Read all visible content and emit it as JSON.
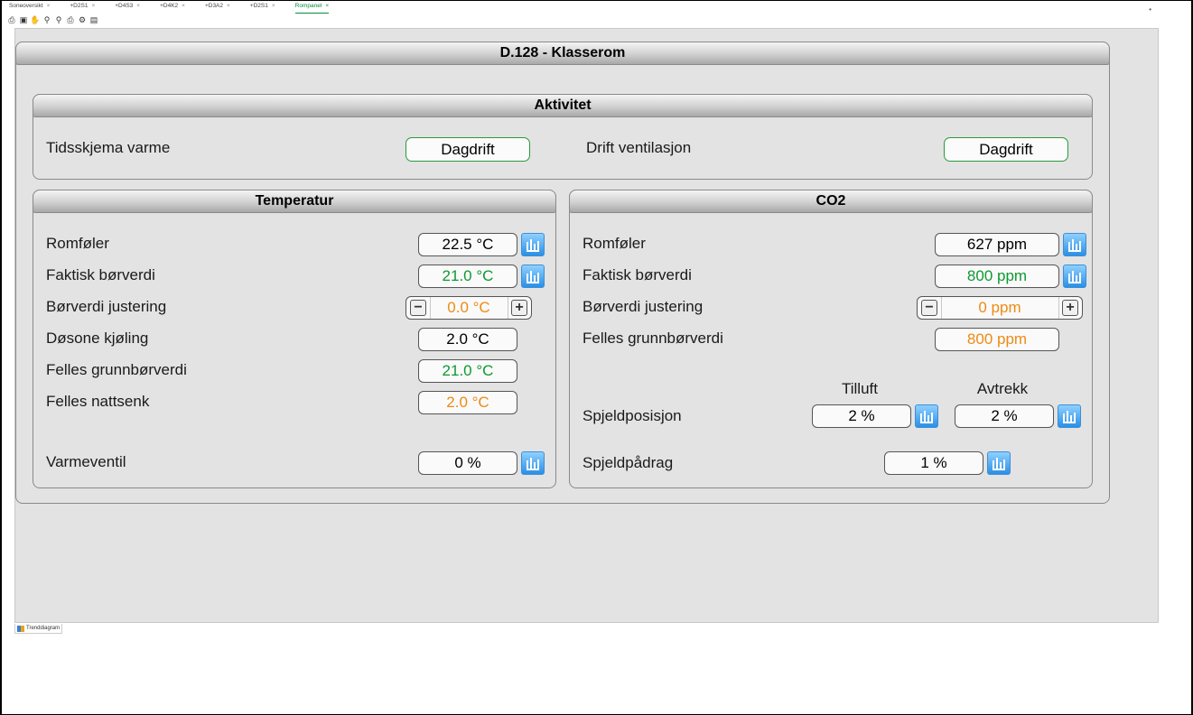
{
  "tabs": [
    {
      "label": "Soneoversikt",
      "close": "×",
      "active": false
    },
    {
      "label": "+D2S1",
      "close": "×",
      "active": false
    },
    {
      "label": "+D4S3",
      "close": "×",
      "active": false
    },
    {
      "label": "+D4K2",
      "close": "×",
      "active": false
    },
    {
      "label": "+D3A2",
      "close": "×",
      "active": false
    },
    {
      "label": "+D2S1",
      "close": "×",
      "active": false
    },
    {
      "label": "Rompanel",
      "close": "×",
      "active": true
    }
  ],
  "toolbar_icons": [
    "print-icon",
    "save-icon",
    "pan-icon",
    "zoom-in-icon",
    "zoom-out-icon",
    "print-preview-icon",
    "settings-icon",
    "document-icon"
  ],
  "window_dot": "•",
  "room": {
    "title": "D.128 - Klasserom"
  },
  "aktivitet": {
    "title": "Aktivitet",
    "heat_schedule_label": "Tidsskjema varme",
    "heat_schedule_value": "Dagdrift",
    "vent_label": "Drift ventilasjon",
    "vent_value": "Dagdrift"
  },
  "temperatur": {
    "title": "Temperatur",
    "room_sensor_label": "Romføler",
    "room_sensor_value": "22.5 °C",
    "actual_setpoint_label": "Faktisk børverdi",
    "actual_setpoint_value": "21.0 °C",
    "setpoint_adjust_label": "Børverdi justering",
    "setpoint_adjust_value": "0.0 °C",
    "minus": "−",
    "plus": "+",
    "deadband_label": "Døsone kjøling",
    "deadband_value": "2.0 °C",
    "common_base_label": "Felles grunnbørverdi",
    "common_base_value": "21.0 °C",
    "night_setback_label": "Felles nattsenk",
    "night_setback_value": "2.0 °C",
    "heating_valve_label": "Varmeventil",
    "heating_valve_value": "0 %"
  },
  "co2": {
    "title": "CO2",
    "room_sensor_label": "Romføler",
    "room_sensor_value": "627 ppm",
    "actual_setpoint_label": "Faktisk børverdi",
    "actual_setpoint_value": "800 ppm",
    "setpoint_adjust_label": "Børverdi justering",
    "setpoint_adjust_value": "0 ppm",
    "minus": "−",
    "plus": "+",
    "common_base_label": "Felles grunnbørverdi",
    "common_base_value": "800 ppm",
    "supply_header": "Tilluft",
    "exhaust_header": "Avtrekk",
    "damper_pos_label": "Spjeldposisjon",
    "damper_supply_value": "2 %",
    "damper_exhaust_value": "2 %",
    "damper_output_label": "Spjeldpådrag",
    "damper_output_value": "1 %"
  },
  "bottom_tab": {
    "label": "Trenddiagram"
  },
  "colors": {
    "green": "#0d9a30",
    "orange": "#ef8a12",
    "button_border": "#2a9a3c",
    "trend_blue": "#2b8fe6"
  }
}
